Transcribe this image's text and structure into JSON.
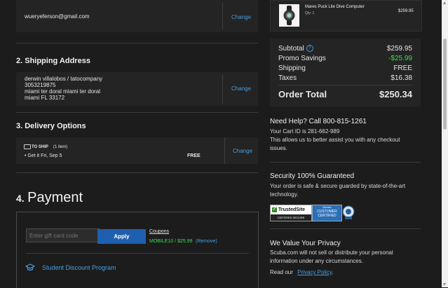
{
  "account": {
    "email": "wueryeferson@gmail.com",
    "change_label": "Change"
  },
  "shipping": {
    "heading": "2. Shipping Address",
    "lines": [
      "derwin villalobos / tatocompany",
      "3053219875",
      "miami ter doral miami ter doral",
      "miami FL 33172"
    ],
    "change_label": "Change"
  },
  "delivery": {
    "heading": "3. Delivery Options",
    "method": "TO SHIP",
    "count": "(1 item)",
    "eta": "• Get it Fri, Sep 5",
    "price": "FREE",
    "change_label": "Change"
  },
  "payment": {
    "number": "4.",
    "title": "Payment",
    "gift_placeholder": "Enter gift card code",
    "apply_label": "Apply",
    "coupons_label": "Coupons",
    "coupon_code": "MOBILE10 / $25.99",
    "remove_label": "(Remove)",
    "student_label": "Student Discount Program"
  },
  "cart_item": {
    "name": "Mares Puck Lite Dive Computer",
    "qty": "Qty: 1",
    "price": "$259.95"
  },
  "summary": {
    "subtotal_label": "Subtotal",
    "subtotal": "$259.95",
    "promo_label": "Promo Savings",
    "promo": "-$25.99",
    "shipping_label": "Shipping",
    "shipping": "FREE",
    "taxes_label": "Taxes",
    "taxes": "$16.38",
    "total_label": "Order Total",
    "total": "$250.34"
  },
  "help": {
    "title": "Need Help? Call 800-815-1261",
    "cart_id": "Your Cart ID is 281-662-989",
    "assist": "This allows us to better assist you with any checkout issues."
  },
  "security": {
    "title": "Security 100% Guaranteed",
    "text": "Your order is safe & secure guarded by state-of-the-art technology.",
    "badges": {
      "trustedsite_name": "TrustedSite",
      "trustedsite_sub": "CERTIFIED SECURE",
      "bizrate_top": "Bizrate",
      "bizrate_main": "CUSTOMER CERTIFIED"
    }
  },
  "privacy": {
    "title": "We Value Your Privacy",
    "text": "Scuba.com will not sell or distribute your personal information under any circumstances.",
    "read_label": "Read our",
    "policy_link": "Privacy Policy",
    "period": "."
  },
  "colors": {
    "accent": "#4a9ee6",
    "apply_btn": "#1f5fb0",
    "promo_green": "#3ddc57",
    "panel": "#232423",
    "bg": "#1b1c1b"
  }
}
